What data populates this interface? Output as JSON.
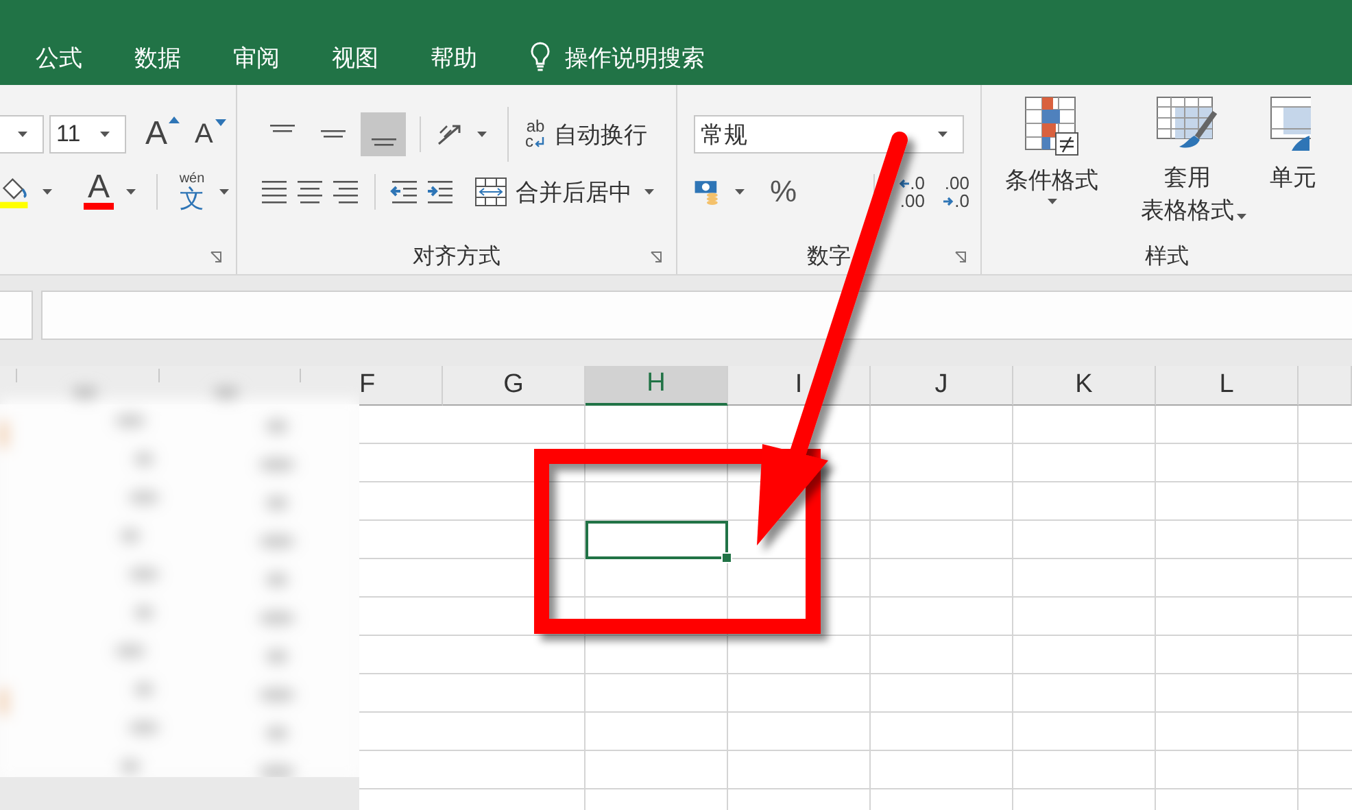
{
  "tabs": [
    {
      "label": "公式"
    },
    {
      "label": "数据"
    },
    {
      "label": "审阅"
    },
    {
      "label": "视图"
    },
    {
      "label": "帮助"
    }
  ],
  "tell_me": {
    "label": "操作说明搜索"
  },
  "ribbon": {
    "font_group": {
      "font_size": "11",
      "grow_glyph": "A",
      "shrink_glyph": "A",
      "font_color_glyph": "A",
      "phonetic": {
        "top": "wén",
        "glyph": "文"
      }
    },
    "alignment_group": {
      "title": "对齐方式",
      "vertical_align": [
        {
          "selected": false
        },
        {
          "selected": false
        },
        {
          "selected": true
        }
      ],
      "wrap_text": {
        "icon_top": "ab",
        "icon_bottom": "c",
        "label": "自动换行"
      },
      "merge": {
        "label": "合并后居中"
      }
    },
    "number_group": {
      "title": "数字",
      "format": "常规",
      "percent": "%",
      "increase_decimal": {
        "top": ".0",
        "bottom": ".00"
      },
      "decrease_decimal": {
        "top": ".00",
        "bottom": ".0"
      }
    },
    "styles_group": {
      "title": "样式",
      "buttons": [
        {
          "kind": "conditional",
          "lines": [
            "条件格式"
          ]
        },
        {
          "kind": "table",
          "lines": [
            "套用",
            "表格格式"
          ]
        },
        {
          "kind": "cell",
          "lines": [
            "单元"
          ]
        }
      ]
    }
  },
  "sheet": {
    "columns": [
      {
        "label": "F",
        "selected": false
      },
      {
        "label": "G",
        "selected": false
      },
      {
        "label": "H",
        "selected": true
      },
      {
        "label": "I",
        "selected": false
      },
      {
        "label": "J",
        "selected": false
      },
      {
        "label": "K",
        "selected": false
      },
      {
        "label": "L",
        "selected": false
      }
    ],
    "rows": [
      {
        "selected": false
      },
      {
        "selected": false
      },
      {
        "selected": false
      },
      {
        "selected": true
      },
      {
        "selected": false
      },
      {
        "selected": false
      },
      {
        "selected": false
      },
      {
        "selected": false
      },
      {
        "selected": false
      },
      {
        "selected": false
      },
      {
        "selected": false
      }
    ]
  },
  "annotations": [
    {
      "kind": "box"
    },
    {
      "kind": "arrow"
    }
  ]
}
